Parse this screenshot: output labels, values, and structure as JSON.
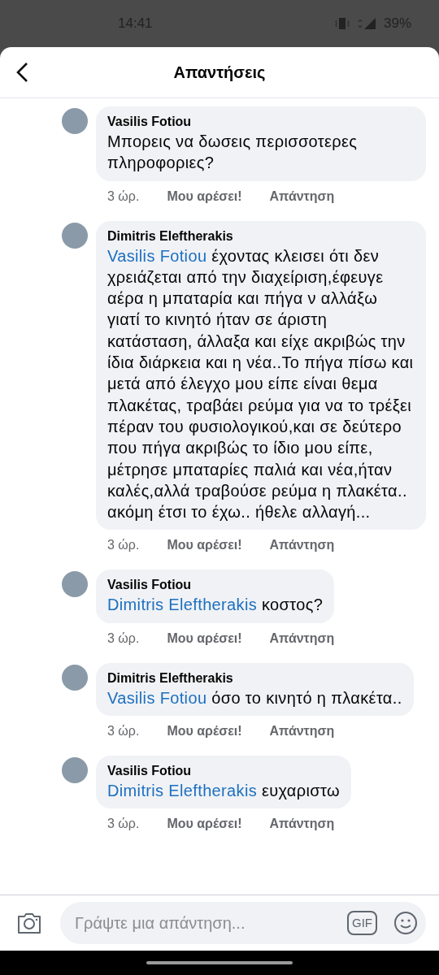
{
  "status_bar": {
    "time": "14:41",
    "battery": "39%"
  },
  "header": {
    "title": "Απαντήσεις"
  },
  "comments": [
    {
      "author": "Vasilis Fotiou",
      "text": "Μπορεις να δωσεις περισσοτερες πληροφοριες?",
      "time": "3 ώρ.",
      "like": "Μου αρέσει!",
      "reply": "Απάντηση"
    },
    {
      "author": "Dimitris Eleftherakis",
      "mention": "Vasilis Fotiou",
      "text": "έχοντας κλεισει ότι δεν χρειάζεται από την διαχείριση,έφευγε αέρα η μπαταρία και πήγα ν αλλάξω γιατί το κινητό ήταν σε άριστη κατάσταση, άλλαξα και είχε ακριβώς την ίδια διάρκεια και η νέα..Το πήγα πίσω και μετά από έλεγχο μου είπε είναι θεμα πλακέτας, τραβάει ρεύμα για να το τρέξει πέραν του φυσιολογικού,και σε δεύτερο που πήγα ακριβώς το ίδιο μου είπε, μέτρησε μπαταρίες παλιά και νέα,ήταν καλές,αλλά τραβούσε ρεύμα η πλακέτα.. ακόμη έτσι το έχω.. ήθελε αλλαγή...",
      "time": "3 ώρ.",
      "like": "Μου αρέσει!",
      "reply": "Απάντηση"
    },
    {
      "author": "Vasilis Fotiou",
      "mention": "Dimitris Eleftherakis",
      "text": "κοστος?",
      "time": "3 ώρ.",
      "like": "Μου αρέσει!",
      "reply": "Απάντηση"
    },
    {
      "author": "Dimitris Eleftherakis",
      "mention": "Vasilis Fotiou",
      "text": "όσο το κινητό η πλακέτα..",
      "time": "3 ώρ.",
      "like": "Μου αρέσει!",
      "reply": "Απάντηση"
    },
    {
      "author": "Vasilis Fotiou",
      "mention": "Dimitris Eleftherakis",
      "text": "ευχαριστω",
      "time": "3 ώρ.",
      "like": "Μου αρέσει!",
      "reply": "Απάντηση"
    }
  ],
  "reply_bar": {
    "placeholder": "Γράψτε μια απάντηση...",
    "gif": "GIF"
  }
}
